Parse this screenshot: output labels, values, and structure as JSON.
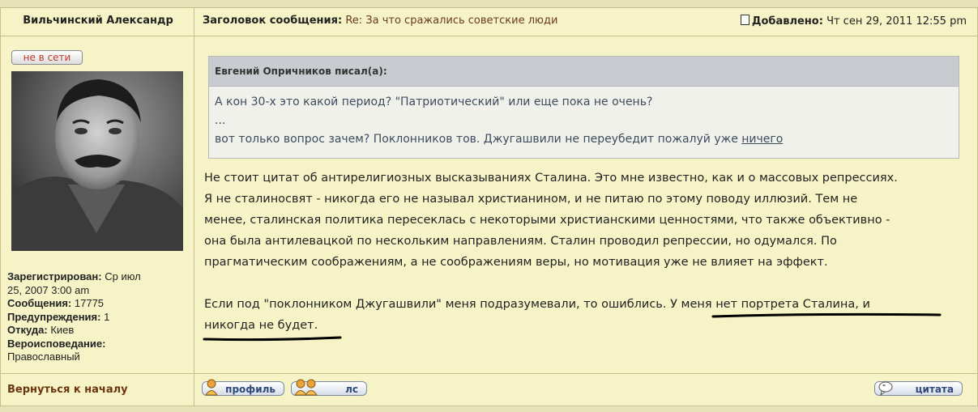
{
  "header": {
    "author": "Вильчинский Александр",
    "subject_label": "Заголовок сообщения:",
    "subject_value": "Re: За что сражались советские люди",
    "posted_label": "Добавлено:",
    "posted_value": "Чт сен 29, 2011 12:55 pm"
  },
  "user": {
    "status": "не в сети",
    "avatar_icon": "avatar-photo",
    "registered_label": "Зарегистрирован:",
    "registered_value_1": "Ср июл",
    "registered_value_2": "25, 2007 3:00 am",
    "posts_label": "Сообщения:",
    "posts_value": "17775",
    "warnings_label": "Предупреждения:",
    "warnings_value": "1",
    "from_label": "Откуда:",
    "from_value": "Киев",
    "religion_label": "Вероисповедание:",
    "religion_value": "Православный"
  },
  "quote": {
    "author": "Евгений Опричников писал(а):",
    "line1": "А кон 30-х это какой период? \"Патриотический\" или еще пока не очень?",
    "line2": "...",
    "line3": "вот только вопрос зачем? Поклонников тов. Джугашвили не переубедит пожалуй уже",
    "line3_link": "ничего"
  },
  "message": {
    "line1": "Не стоит цитат об антирелигиозных высказываниях Сталина. Это мне известно, как и о массовых репрессиях.",
    "line2": "Я не сталиносвят - никогда его не называл христианином, и не питаю по этому поводу иллюзий. Тем не",
    "line3": "менее, сталинская политика пересеклась с некоторыми христианскими ценностями, что также объективно -",
    "line4": "она была антилевацкой по нескольким направлениям. Сталин проводил репрессии, но одумался. По",
    "line5": "прагматическим соображениям, а не соображениям веры, но мотивация уже не влияет на эффект.",
    "line6": "Если под \"поклонником Джугашвили\" меня подразумевали, то ошиблись. У меня нет портрета Сталина, и",
    "line7": "никогда не будет."
  },
  "footer": {
    "back_to_top": "Вернуться к началу",
    "profile_button": "профиль",
    "pm_button": "лс",
    "quote_button": "цитата"
  },
  "colors": {
    "background": "#f6f4c7",
    "border": "#c6bf8b",
    "accent_brown": "#6b3a1a",
    "button_text": "#2f4a7a",
    "offline_red": "#c0392b"
  }
}
